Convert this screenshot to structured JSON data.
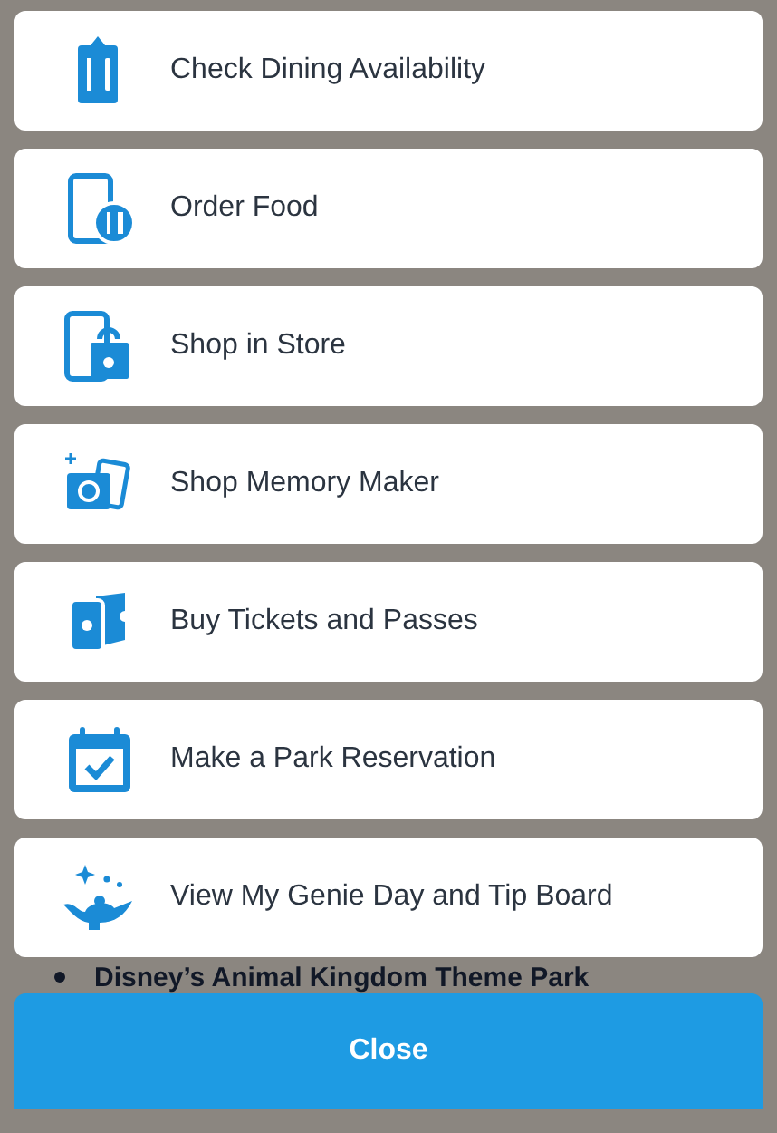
{
  "menu_items": [
    {
      "label": "Check Dining Availability"
    },
    {
      "label": "Order Food"
    },
    {
      "label": "Shop in Store"
    },
    {
      "label": "Shop Memory Maker"
    },
    {
      "label": "Buy Tickets and Passes"
    },
    {
      "label": "Make a Park Reservation"
    },
    {
      "label": "View My Genie Day and Tip Board"
    }
  ],
  "background_bullet": "Disney’s Animal Kingdom Theme Park",
  "close_button": "Close"
}
